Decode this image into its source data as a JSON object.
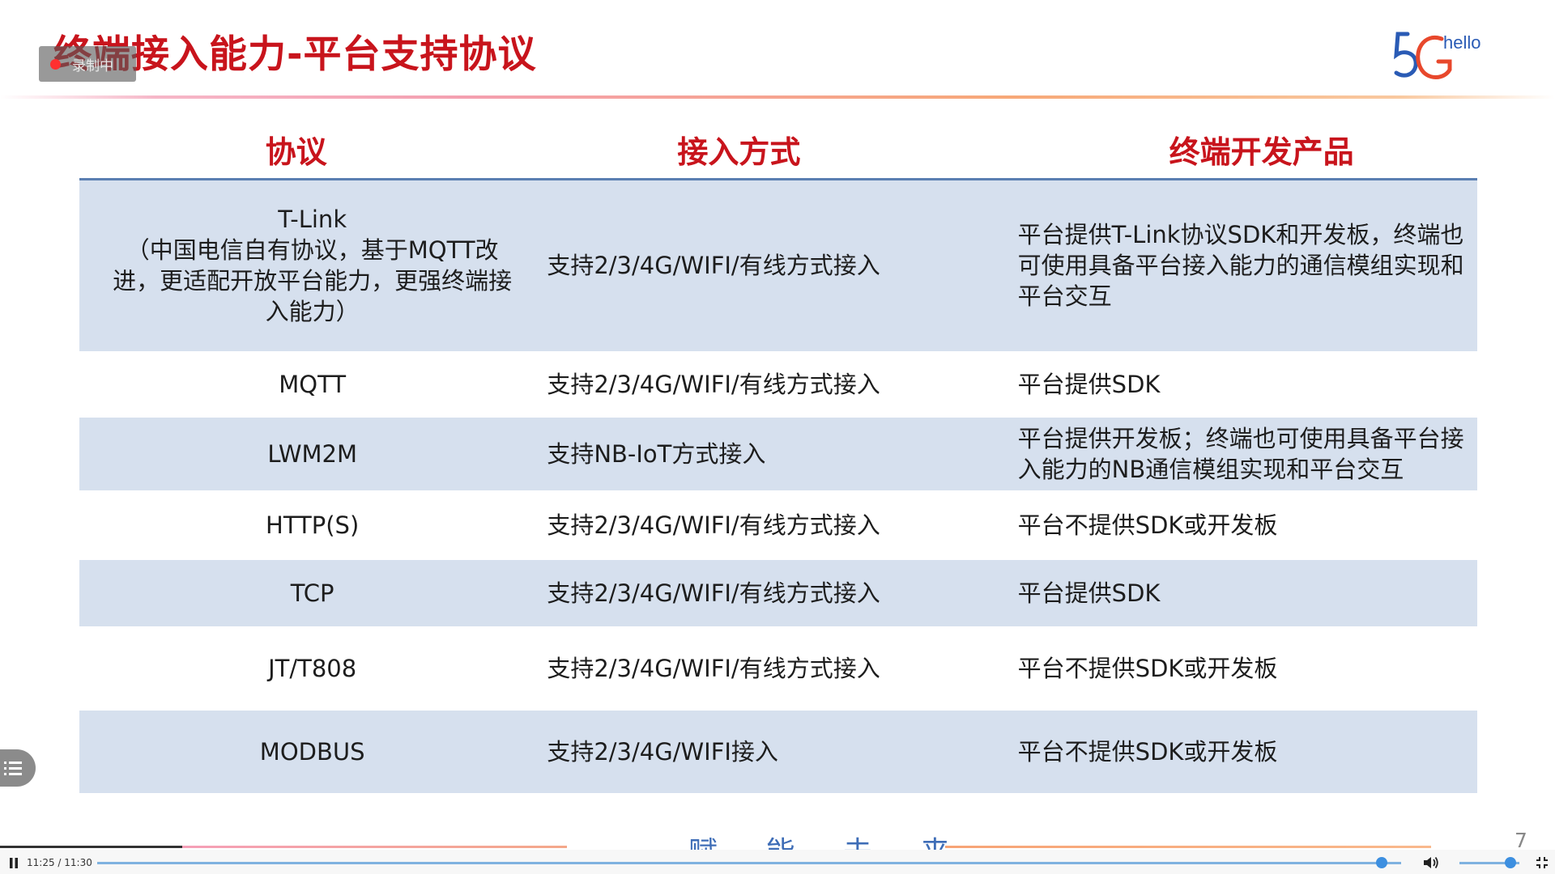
{
  "slide": {
    "title": "终端接入能力-平台支持协议",
    "page_number": "7",
    "footer_text": "赋 能 未 来",
    "logo_text": "hello"
  },
  "recording": {
    "label": "录制中"
  },
  "table": {
    "headers": [
      "协议",
      "接入方式",
      "终端开发产品"
    ],
    "rows": [
      {
        "protocol": "T-Link",
        "protocol_note": "（中国电信自有协议，基于MQTT改进，更适配开放平台能力，更强终端接入能力）",
        "access": "支持2/3/4G/WIFI/有线方式接入",
        "product": "平台提供T-Link协议SDK和开发板，终端也可使用具备平台接入能力的通信模组实现和平台交互",
        "shaded": true
      },
      {
        "protocol": "MQTT",
        "access": "支持2/3/4G/WIFI/有线方式接入",
        "product": "平台提供SDK",
        "shaded": false
      },
      {
        "protocol": "LWM2M",
        "access": "支持NB-IoT方式接入",
        "product": "平台提供开发板；终端也可使用具备平台接入能力的NB通信模组实现和平台交互",
        "shaded": true
      },
      {
        "protocol": "HTTP(S)",
        "access": "支持2/3/4G/WIFI/有线方式接入",
        "product": "平台不提供SDK或开发板",
        "shaded": false
      },
      {
        "protocol": "TCP",
        "access": "支持2/3/4G/WIFI/有线方式接入",
        "product": "平台提供SDK",
        "shaded": true
      },
      {
        "protocol": "JT/T808",
        "access": "支持2/3/4G/WIFI/有线方式接入",
        "product": "平台不提供SDK或开发板",
        "shaded": false
      },
      {
        "protocol": "MODBUS",
        "access": "支持2/3/4G/WIFI接入",
        "product": "平台不提供SDK或开发板",
        "shaded": true
      }
    ]
  },
  "player": {
    "time": "11:25 / 11:30",
    "progress": 0.985,
    "volume": 0.85
  },
  "colors": {
    "title_red": "#c8141c",
    "row_shade": "#d6e0ee",
    "header_rule": "#5b7fb2",
    "accent_blue": "#3d8fe0"
  },
  "icons": [
    "record-dot-icon",
    "pause-icon",
    "volume-icon",
    "fullscreen-icon",
    "menu-list-icon",
    "logo-5g-icon"
  ]
}
